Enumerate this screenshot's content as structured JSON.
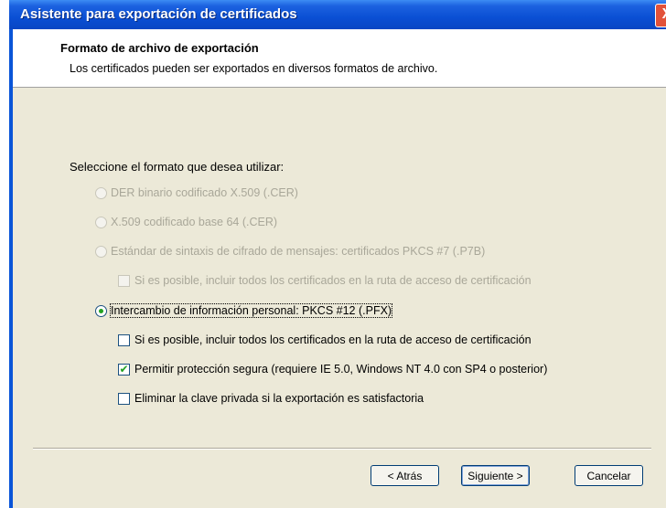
{
  "window": {
    "title": "Asistente para exportación de certificados",
    "close_glyph": "X"
  },
  "header": {
    "title": "Formato de archivo de exportación",
    "description": "Los certificados pueden ser exportados en diversos formatos de archivo."
  },
  "prompt": "Seleccione el formato que desea utilizar:",
  "options": [
    {
      "label": "DER binario codificado X.509 (.CER)",
      "enabled": false,
      "selected": false
    },
    {
      "label": "X.509 codificado base 64 (.CER)",
      "enabled": false,
      "selected": false
    },
    {
      "label": "Estándar de sintaxis de cifrado de mensajes: certificados PKCS #7 (.P7B)",
      "enabled": false,
      "selected": false
    },
    {
      "label": "Intercambio de información personal: PKCS #12 (.PFX)",
      "enabled": true,
      "selected": true
    }
  ],
  "pkcs7_include_all": {
    "label": "Si es posible, incluir todos los certificados en la ruta de acceso de certificación",
    "enabled": false,
    "checked": false
  },
  "pkcs12_options": [
    {
      "label": "Si es posible, incluir todos los certificados en la ruta de acceso de certificación",
      "checked": false
    },
    {
      "label": "Permitir protección segura (requiere IE 5.0, Windows NT 4.0 con SP4 o posterior)",
      "checked": true
    },
    {
      "label": "Eliminar la clave privada si la exportación es satisfactoria",
      "checked": false
    }
  ],
  "buttons": {
    "back": "< Atrás",
    "next": "Siguiente >",
    "cancel": "Cancelar"
  },
  "colors": {
    "title_bar": "#0a4fd4",
    "dialog_face": "#ece9d8",
    "check_mark": "#21a121"
  }
}
